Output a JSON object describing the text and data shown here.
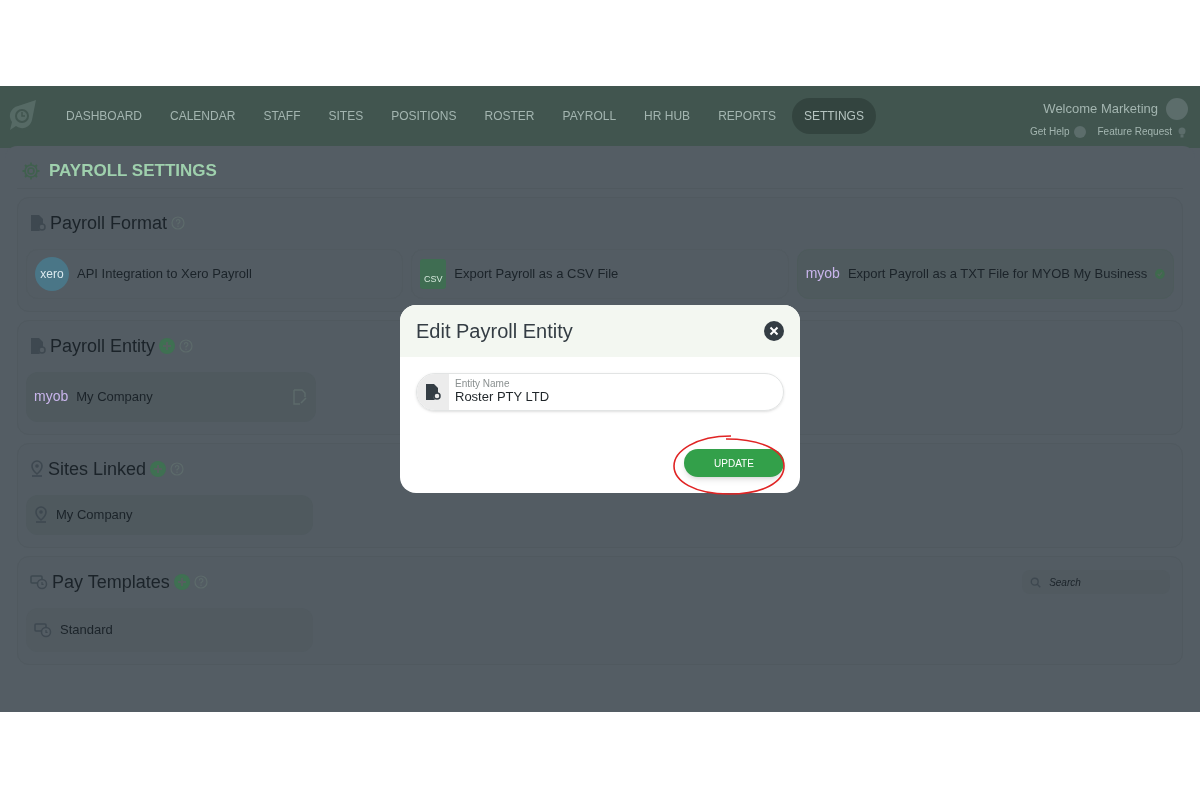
{
  "nav": {
    "items": [
      {
        "label": "DASHBOARD",
        "selected": false
      },
      {
        "label": "CALENDAR",
        "selected": false
      },
      {
        "label": "STAFF",
        "selected": false
      },
      {
        "label": "SITES",
        "selected": false
      },
      {
        "label": "POSITIONS",
        "selected": false
      },
      {
        "label": "ROSTER",
        "selected": false
      },
      {
        "label": "PAYROLL",
        "selected": false
      },
      {
        "label": "HR HUB",
        "selected": false
      },
      {
        "label": "REPORTS",
        "selected": false
      },
      {
        "label": "SETTINGS",
        "selected": true
      }
    ],
    "welcome": "Welcome Marketing",
    "help": "Get Help",
    "feature": "Feature Request"
  },
  "page_title": "PAYROLL SETTINGS",
  "payroll_format": {
    "title": "Payroll Format",
    "options": [
      {
        "kind": "xero",
        "logo": "xero",
        "label": "API Integration to Xero Payroll",
        "selected": false
      },
      {
        "kind": "csv",
        "logo": "CSV",
        "label": "Export Payroll as a CSV File",
        "selected": false
      },
      {
        "kind": "myob",
        "logo": "myob",
        "label": "Export Payroll as a TXT File for MYOB My Business",
        "selected": true
      }
    ]
  },
  "payroll_entity": {
    "title": "Payroll Entity",
    "items": [
      {
        "logo": "myob",
        "label": "My Company"
      }
    ]
  },
  "sites_linked": {
    "title": "Sites Linked",
    "items": [
      {
        "label": "My Company"
      }
    ]
  },
  "pay_templates": {
    "title": "Pay Templates",
    "search": {
      "placeholder": "Search"
    },
    "items": [
      {
        "label": "Standard"
      }
    ]
  },
  "modal": {
    "title": "Edit Payroll Entity",
    "field": {
      "label": "Entity Name",
      "value": "Roster PTY LTD"
    },
    "button": "UPDATE"
  }
}
